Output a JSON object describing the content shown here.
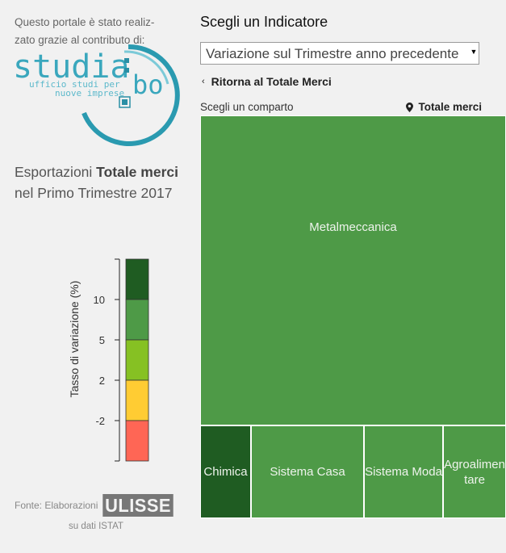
{
  "sidebar": {
    "intro_line1": "Questo portale è stato realiz-",
    "intro_line2": "zato grazie al contributo di:",
    "logo": {
      "word": "studia",
      "suffix": "bo",
      "tagline1": "ufficio studi per",
      "tagline2": "nuove imprese"
    },
    "headline": {
      "prefix": "Esportazioni ",
      "bold": "Totale merci",
      "line2": "nel Primo Trimestre 2017"
    },
    "legend": {
      "axis_label": "Tasso di variazione (%)",
      "ticks": [
        "10",
        "5",
        "2",
        "-2"
      ],
      "colors": [
        "#1f5c22",
        "#4e9a47",
        "#86c123",
        "#ffcc33",
        "#ff6655"
      ]
    },
    "source": {
      "prefix": "Fonte: Elaborazioni",
      "brand": "ULISSE",
      "line2": "su dati ISTAT"
    }
  },
  "main": {
    "indicator_title": "Scegli un Indicatore",
    "indicator_select": "Variazione sul Trimestre anno precedente",
    "back_link": "Ritorna al Totale Merci",
    "choose_label": "Scegli un comparto",
    "total_label": "Totale merci",
    "treemap": [
      {
        "label": "Metalmeccanica",
        "color": "#4e9a47"
      },
      {
        "label": "Chimica",
        "color": "#1f5c22"
      },
      {
        "label": "Sistema Casa",
        "color": "#4e9a47"
      },
      {
        "label": "Sistema Moda",
        "color": "#4e9a47"
      },
      {
        "label": "Agroalimentare",
        "label_wrapped": "Agroalimen\ntare",
        "color": "#4e9a47"
      }
    ]
  }
}
